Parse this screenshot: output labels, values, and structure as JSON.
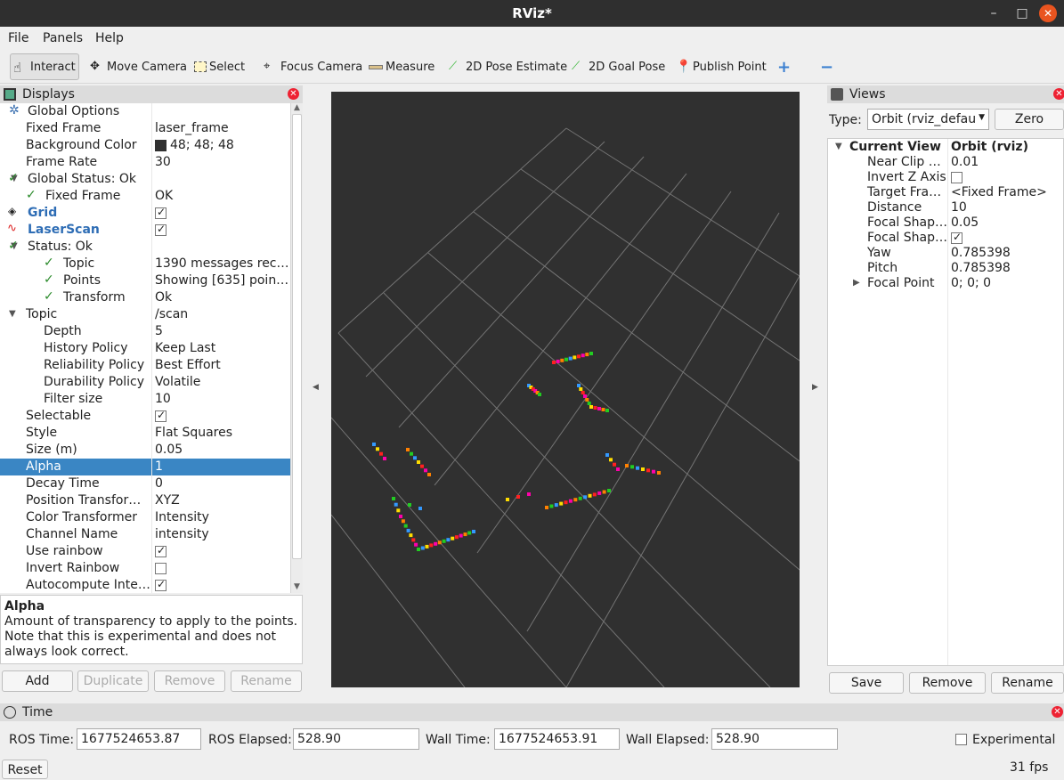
{
  "window": {
    "title": "RViz*",
    "min": "–",
    "max": "□",
    "close": "✕"
  },
  "menu": [
    "File",
    "Panels",
    "Help"
  ],
  "toolbar": {
    "interact": "Interact",
    "move_camera": "Move Camera",
    "select": "Select",
    "focus_camera": "Focus Camera",
    "measure": "Measure",
    "pose": "2D Pose Estimate",
    "goal": "2D Goal Pose",
    "publish": "Publish Point"
  },
  "displays": {
    "title": "Displays",
    "rows": [
      {
        "k": "Global Options",
        "v": ""
      },
      {
        "k": "Fixed Frame",
        "v": "laser_frame"
      },
      {
        "k": "Background Color",
        "v": "48; 48; 48"
      },
      {
        "k": "Frame Rate",
        "v": "30"
      },
      {
        "k": "Global Status: Ok",
        "v": ""
      },
      {
        "k": "Fixed Frame",
        "v": "OK"
      },
      {
        "k": "Grid",
        "v": ""
      },
      {
        "k": "LaserScan",
        "v": ""
      },
      {
        "k": "Status: Ok",
        "v": ""
      },
      {
        "k": "Topic",
        "v": "1390 messages rec…"
      },
      {
        "k": "Points",
        "v": "Showing [635] poin…"
      },
      {
        "k": "Transform",
        "v": "Ok"
      },
      {
        "k": "Topic",
        "v": "/scan"
      },
      {
        "k": "Depth",
        "v": "5"
      },
      {
        "k": "History Policy",
        "v": "Keep Last"
      },
      {
        "k": "Reliability Policy",
        "v": "Best Effort"
      },
      {
        "k": "Durability Policy",
        "v": "Volatile"
      },
      {
        "k": "Filter size",
        "v": "10"
      },
      {
        "k": "Selectable",
        "v": ""
      },
      {
        "k": "Style",
        "v": "Flat Squares"
      },
      {
        "k": "Size (m)",
        "v": "0.05"
      },
      {
        "k": "Alpha",
        "v": "1"
      },
      {
        "k": "Decay Time",
        "v": "0"
      },
      {
        "k": "Position Transfor…",
        "v": "XYZ"
      },
      {
        "k": "Color Transformer",
        "v": "Intensity"
      },
      {
        "k": "Channel Name",
        "v": "intensity"
      },
      {
        "k": "Use rainbow",
        "v": ""
      },
      {
        "k": "Invert Rainbow",
        "v": ""
      },
      {
        "k": "Autocompute Inte…",
        "v": ""
      }
    ],
    "help_title": "Alpha",
    "help_text": "Amount of transparency to apply to the points. Note that this is experimental and does not always look correct.",
    "buttons": {
      "add": "Add",
      "duplicate": "Duplicate",
      "remove": "Remove",
      "rename": "Rename"
    }
  },
  "views": {
    "title": "Views",
    "type_label": "Type:",
    "type_value": "Orbit (rviz_defau",
    "zero": "Zero",
    "rows": [
      {
        "k": "Current View",
        "v": "Orbit (rviz)"
      },
      {
        "k": "Near Clip …",
        "v": "0.01"
      },
      {
        "k": "Invert Z Axis",
        "v": ""
      },
      {
        "k": "Target Fra…",
        "v": "<Fixed Frame>"
      },
      {
        "k": "Distance",
        "v": "10"
      },
      {
        "k": "Focal Shap…",
        "v": "0.05"
      },
      {
        "k": "Focal Shap…",
        "v": ""
      },
      {
        "k": "Yaw",
        "v": "0.785398"
      },
      {
        "k": "Pitch",
        "v": "0.785398"
      },
      {
        "k": "Focal Point",
        "v": "0; 0; 0"
      }
    ],
    "buttons": {
      "save": "Save",
      "remove": "Remove",
      "rename": "Rename"
    }
  },
  "time": {
    "title": "Time",
    "ros_time_label": "ROS Time:",
    "ros_time": "1677524653.87",
    "ros_elapsed_label": "ROS Elapsed:",
    "ros_elapsed": "528.90",
    "wall_time_label": "Wall Time:",
    "wall_time": "1677524653.91",
    "wall_elapsed_label": "Wall Elapsed:",
    "wall_elapsed": "528.90",
    "experimental": "Experimental",
    "reset": "Reset",
    "fps": "31 fps"
  },
  "colors": {
    "background": "#303030",
    "selection": "#3a86c4",
    "accent_red": "#e23"
  }
}
